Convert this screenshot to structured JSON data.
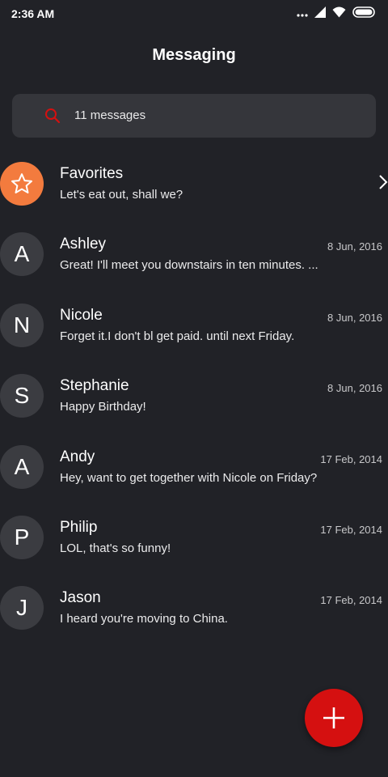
{
  "status_bar": {
    "time": "2:36 AM",
    "icons": [
      "more-dots-icon",
      "signal-icon",
      "wifi-icon",
      "battery-icon"
    ]
  },
  "header": {
    "title": "Messaging"
  },
  "search": {
    "text": "11 messages",
    "icon": "search-icon"
  },
  "conversations": [
    {
      "avatar": "",
      "name": "Favorites",
      "preview": "Let's eat out, shall we?",
      "date": "",
      "type": "favorite"
    },
    {
      "avatar": "A",
      "name": "Ashley",
      "preview": "Great! I'll meet you downstairs in ten minutes. ...",
      "date": "8 Jun, 2016"
    },
    {
      "avatar": "N",
      "name": "Nicole",
      "preview": "Forget it.I don't bl get paid. until next Friday.",
      "date": "8 Jun, 2016"
    },
    {
      "avatar": "S",
      "name": "Stephanie",
      "preview": "Happy Birthday!",
      "date": "8 Jun, 2016"
    },
    {
      "avatar": "A",
      "name": "Andy",
      "preview": "Hey, want to get together with Nicole on Friday?",
      "date": "17 Feb, 2014"
    },
    {
      "avatar": "P",
      "name": "Philip",
      "preview": "LOL, that's so funny!",
      "date": "17 Feb, 2014"
    },
    {
      "avatar": "J",
      "name": "Jason",
      "preview": "I heard you're moving to China.",
      "date": "17 Feb, 2014"
    }
  ],
  "fab": {
    "icon": "plus-icon"
  },
  "colors": {
    "background": "#212227",
    "search_bg": "#35363b",
    "avatar_bg": "#3b3c41",
    "favorite_accent": "#f37b3e",
    "fab": "#d51010",
    "search_icon": "#d51010"
  }
}
